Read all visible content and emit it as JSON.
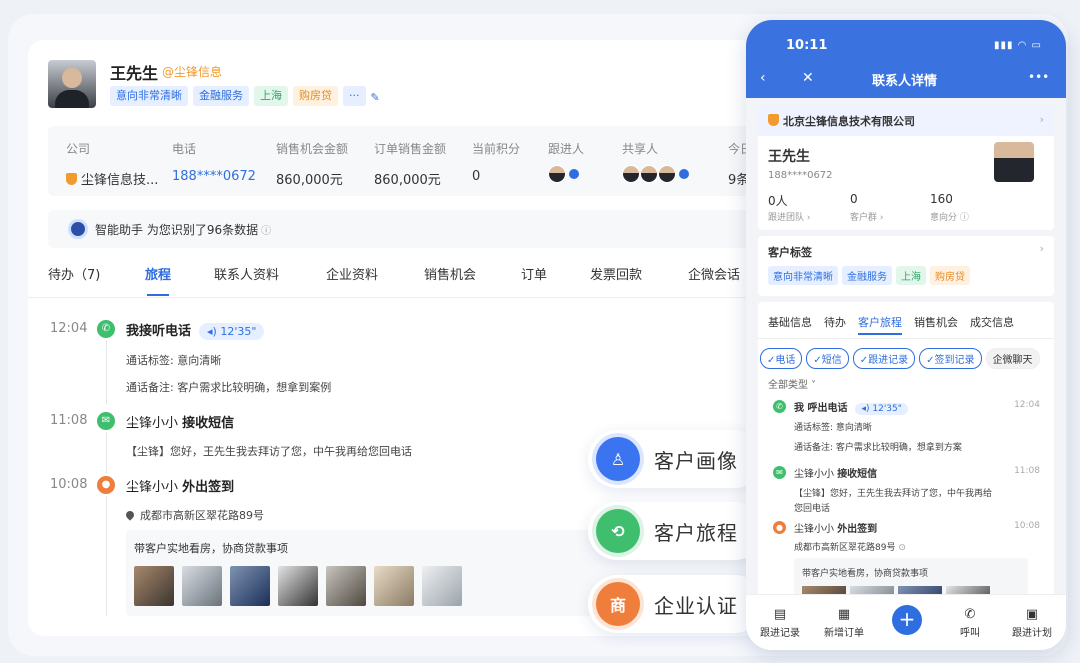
{
  "customer": {
    "name": "王先生",
    "company_handle": "@尘锋信息",
    "tags": [
      {
        "label": "意向非常清晰",
        "style": "blue"
      },
      {
        "label": "金融服务",
        "style": "blue"
      },
      {
        "label": "上海",
        "style": "green"
      },
      {
        "label": "购房贷",
        "style": "orange"
      }
    ],
    "more": "···"
  },
  "info": {
    "company": {
      "label": "公司",
      "value": "尘锋信息技..."
    },
    "phone": {
      "label": "电话",
      "value": "188****0672"
    },
    "opportunity": {
      "label": "销售机会金额",
      "value": "860,000元"
    },
    "orders": {
      "label": "订单销售金额",
      "value": "860,000元"
    },
    "points": {
      "label": "当前积分",
      "value": "0"
    },
    "follower": {
      "label": "跟进人"
    },
    "sharers": {
      "label": "共享人"
    },
    "today": {
      "label": "今日",
      "value": "9条"
    }
  },
  "assistant": {
    "text": "智能助手 为您识别了96条数据",
    "info_icon": "ⓘ"
  },
  "tabs": [
    "待办（7)",
    "旅程",
    "联系人资料",
    "企业资料",
    "销售机会",
    "订单",
    "发票回款",
    "企微会话"
  ],
  "active_tab": 1,
  "timeline": [
    {
      "time": "12:04",
      "icon": "phone-icon",
      "title": "我接听电话",
      "duration": "12'35\"",
      "lines": [
        "通话标签: 意向清晰",
        "通话备注: 客户需求比较明确，想拿到案例"
      ]
    },
    {
      "time": "11:08",
      "icon": "message-icon",
      "actor": "尘锋小小",
      "action": "接收短信",
      "lines": [
        "【尘锋】您好，王先生我去拜访了您，中午我再给您回电话"
      ]
    },
    {
      "time": "10:08",
      "icon": "location-icon",
      "actor": "尘锋小小",
      "action": "外出签到",
      "address": "成都市高新区翠花路89号",
      "photo_caption": "带客户实地看房，协商贷款事项"
    }
  ],
  "floating": [
    {
      "label": "客户画像",
      "icon": "portrait-icon",
      "color": "blue"
    },
    {
      "label": "客户旅程",
      "icon": "journey-icon",
      "color": "green"
    },
    {
      "label": "企业认证",
      "icon": "certification-icon",
      "color": "orange",
      "glyph": "商"
    }
  ],
  "phone": {
    "time": "10:11",
    "title": "联系人详情",
    "more": "•••",
    "company": "北京尘锋信息技术有限公司",
    "name": "王先生",
    "mobile": "188****0672",
    "stats": [
      {
        "value": "0人",
        "label": "跟进团队 ›"
      },
      {
        "value": "0",
        "label": "客户群 ›"
      },
      {
        "value": "160",
        "label": "意向分 ⓘ"
      }
    ],
    "tags_title": "客户标签",
    "tags": [
      {
        "label": "意向非常清晰",
        "style": "blue"
      },
      {
        "label": "金融服务",
        "style": "blue"
      },
      {
        "label": "上海",
        "style": "green"
      },
      {
        "label": "购房贷",
        "style": "orange"
      }
    ],
    "tabs": [
      "基础信息",
      "待办",
      "客户旅程",
      "销售机会",
      "成交信息"
    ],
    "active_tab": 2,
    "filters": [
      "✓电话",
      "✓短信",
      "✓跟进记录",
      "✓签到记录",
      "企微聊天"
    ],
    "type_filter": "全部类型 ˅",
    "timeline": [
      {
        "title": "我 呼出电话",
        "duration": "12'35\"",
        "time": "12:04",
        "lines": [
          "通话标签:   意向清晰",
          "通话备注:  客户需求比较明确，想拿到方案"
        ]
      },
      {
        "actor": "尘锋小小",
        "action": "接收短信",
        "time": "11:08",
        "lines": [
          "【尘锋】您好，王先生我去拜访了您，中午我再给",
          "您回电话"
        ]
      },
      {
        "actor": "尘锋小小",
        "action": "外出签到",
        "time": "10:08",
        "address": "成都市高新区翠花路89号",
        "photo_caption": "带客户实地看房，协商贷款事项"
      }
    ],
    "bottom": [
      {
        "label": "跟进记录",
        "icon": "note-icon"
      },
      {
        "label": "新增订单",
        "icon": "order-icon"
      },
      {
        "label": "呼叫",
        "icon": "call-icon"
      },
      {
        "label": "跟进计划",
        "icon": "plan-icon"
      }
    ],
    "plus": "+"
  },
  "colors": {
    "accent": "#2f6ee0",
    "header_blue": "#3a72e0",
    "green": "#3fbf6d",
    "orange": "#ef7d3c"
  }
}
